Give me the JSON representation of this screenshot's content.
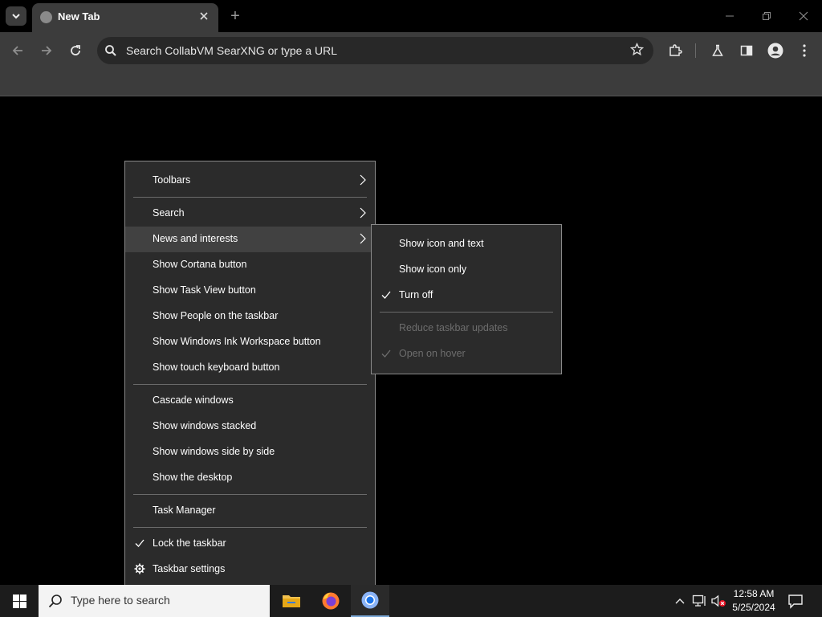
{
  "browser": {
    "tab_title": "New Tab",
    "new_tab_label": "+",
    "omnibox_placeholder": "Search CollabVM SearXNG or type a URL"
  },
  "context_menu": {
    "items": [
      {
        "label": "Toolbars",
        "submenu": true
      },
      {
        "label": "Search",
        "submenu": true
      },
      {
        "label": "News and interests",
        "submenu": true,
        "highlighted": true
      },
      {
        "label": "Show Cortana button"
      },
      {
        "label": "Show Task View button"
      },
      {
        "label": "Show People on the taskbar"
      },
      {
        "label": "Show Windows Ink Workspace button"
      },
      {
        "label": "Show touch keyboard button"
      },
      {
        "label": "Cascade windows"
      },
      {
        "label": "Show windows stacked"
      },
      {
        "label": "Show windows side by side"
      },
      {
        "label": "Show the desktop"
      },
      {
        "label": "Task Manager"
      },
      {
        "label": "Lock the taskbar",
        "checked": true
      },
      {
        "label": "Taskbar settings",
        "icon": "gear-icon"
      }
    ]
  },
  "news_submenu": {
    "items": [
      {
        "label": "Show icon and text"
      },
      {
        "label": "Show icon only"
      },
      {
        "label": "Turn off",
        "checked": true
      },
      {
        "label": "Reduce taskbar updates",
        "disabled": true
      },
      {
        "label": "Open on hover",
        "disabled": true,
        "checked": true
      }
    ]
  },
  "taskbar": {
    "search_placeholder": "Type here to search",
    "apps": [
      "file-explorer-icon",
      "firefox-icon",
      "chrome-icon"
    ],
    "clock_time": "12:58 AM",
    "clock_date": "5/25/2024"
  },
  "colors": {
    "menu_bg": "#2b2b2b",
    "menu_hover": "#414141",
    "chrome_toolbar": "#3c3c3c",
    "taskbar_bg": "#1c1c1c"
  }
}
